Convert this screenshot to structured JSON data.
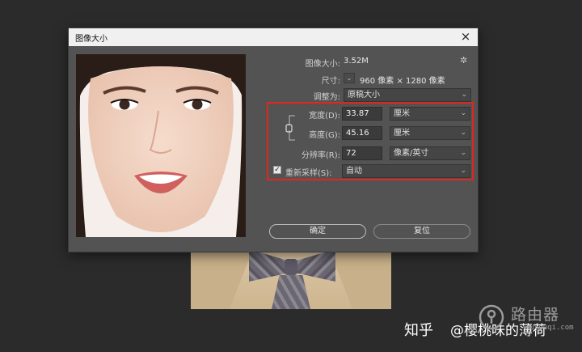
{
  "dialog": {
    "title": "图像大小",
    "close_glyph": "×",
    "image_size_label": "图像大小:",
    "image_size_value": "3.52M",
    "dimensions_label": "尺寸:",
    "dimensions_value": "960 像素  ×  1280 像素",
    "fit_to_label": "调整为:",
    "fit_to_value": "原稿大小",
    "width_label": "宽度(D):",
    "width_value": "33.87",
    "width_unit": "厘米",
    "height_label": "高度(G):",
    "height_value": "45.16",
    "height_unit": "厘米",
    "resolution_label": "分辨率(R):",
    "resolution_value": "72",
    "resolution_unit": "像素/英寸",
    "resample_label": "重新采样(S):",
    "resample_checked": true,
    "resample_value": "自动",
    "ok_label": "确定",
    "reset_label": "复位"
  },
  "icons": [
    "close-icon",
    "gear-icon",
    "chevron-down-icon",
    "link-icon",
    "checkbox-icon"
  ],
  "colors": {
    "highlight": "#e0261f",
    "dialog_bg": "#535353",
    "titlebar_bg": "#f0f0f0"
  },
  "watermark": {
    "zhihu": "知乎",
    "user": "@樱桃味的薄荷",
    "brand": "路由器",
    "domain": "luyouqi.com"
  }
}
